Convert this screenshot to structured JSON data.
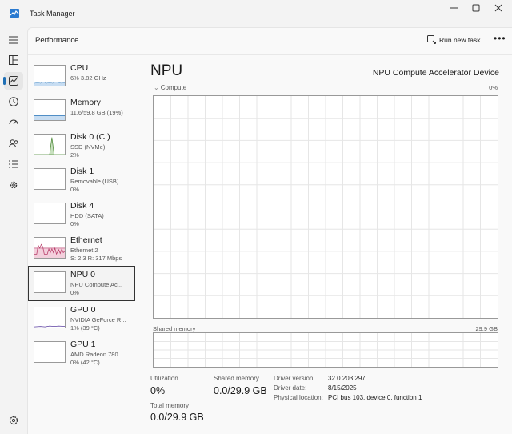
{
  "window": {
    "title": "Task Manager"
  },
  "header": {
    "title": "Performance",
    "run_task_label": "Run new task",
    "more_label": "•••"
  },
  "devices": [
    {
      "name": "CPU",
      "sub": "6%  3.82 GHz",
      "val": ""
    },
    {
      "name": "Memory",
      "sub": "11.6/59.8 GB (19%)",
      "val": ""
    },
    {
      "name": "Disk 0 (C:)",
      "sub": "SSD (NVMe)",
      "val": "2%"
    },
    {
      "name": "Disk 1",
      "sub": "Removable (USB)",
      "val": "0%"
    },
    {
      "name": "Disk 4",
      "sub": "HDD (SATA)",
      "val": "0%"
    },
    {
      "name": "Ethernet",
      "sub": "Ethernet 2",
      "val": "S: 2.3  R: 317 Mbps"
    },
    {
      "name": "NPU 0",
      "sub": "NPU Compute Ac...",
      "val": "0%"
    },
    {
      "name": "GPU 0",
      "sub": "NVIDIA GeForce R...",
      "val": "1% (39 °C)"
    },
    {
      "name": "GPU 1",
      "sub": "AMD Radeon 780...",
      "val": "0% (42 °C)"
    }
  ],
  "selected_device": "NPU 0",
  "main": {
    "title": "NPU",
    "device_name": "NPU Compute Accelerator Device",
    "graph_label": "Compute",
    "graph_max": "0%",
    "shared_label": "Shared memory",
    "shared_max": "29.9 GB"
  },
  "stats": {
    "utilization_label": "Utilization",
    "utilization_value": "0%",
    "shared_label": "Shared memory",
    "shared_value": "0.0/29.9 GB",
    "total_label": "Total memory",
    "total_value": "0.0/29.9 GB"
  },
  "details": [
    {
      "label": "Driver version:",
      "value": "32.0.203.297"
    },
    {
      "label": "Driver date:",
      "value": "8/15/2025"
    },
    {
      "label": "Physical location:",
      "value": "PCI bus 103, device 0, function 1"
    }
  ],
  "colors": {
    "accent": "#1f6fb5",
    "cpu": "#1f6fb5",
    "memory": "#6a5acd",
    "disk": "#4e8a3a",
    "ethernet": "#b83e6a",
    "gpu": "#5b3fa0"
  },
  "icons": [
    "hamburger-icon",
    "processes-icon",
    "performance-icon",
    "app-history-icon",
    "startup-icon",
    "users-icon",
    "details-icon",
    "services-icon",
    "settings-icon"
  ]
}
